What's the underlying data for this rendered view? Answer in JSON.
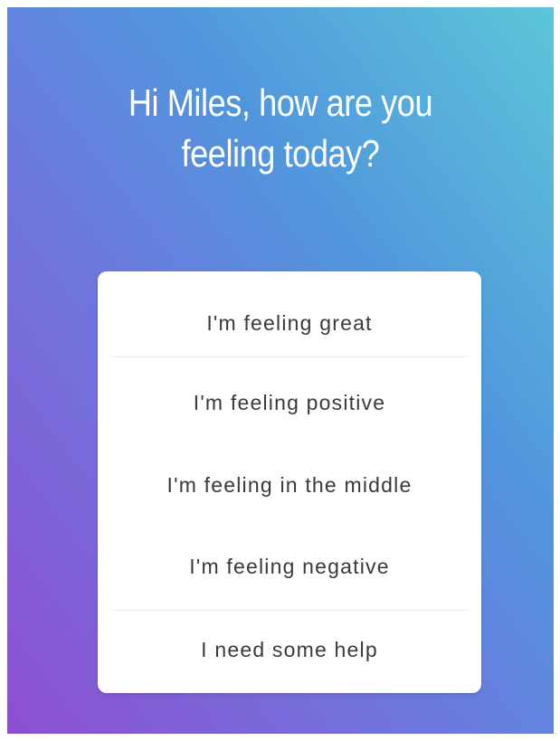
{
  "greeting": {
    "line1": "Hi Miles, how are you",
    "line2": "feeling today?"
  },
  "mood_options": [
    {
      "label": "I'm feeling great"
    },
    {
      "label": "I'm feeling positive"
    },
    {
      "label": "I'm feeling in the middle"
    },
    {
      "label": "I'm feeling negative"
    },
    {
      "label": "I need some help"
    }
  ],
  "colors": {
    "gradient_top_right": "#5cc6d8",
    "gradient_middle": "#5196dd",
    "gradient_bottom_left": "#8e4fd1",
    "card_background": "#ffffff",
    "option_text": "#3a3a3a"
  }
}
